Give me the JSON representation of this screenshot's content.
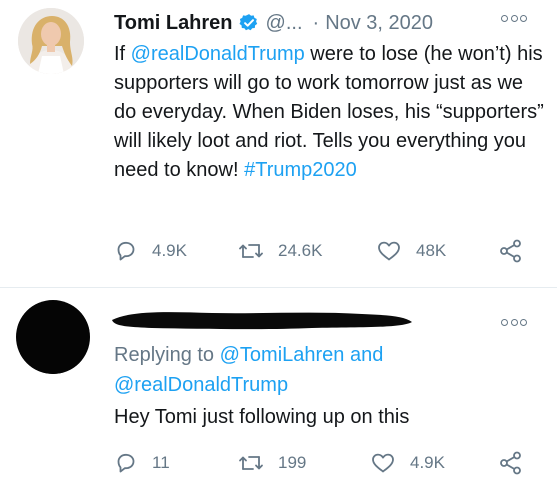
{
  "tweets": [
    {
      "author": {
        "name": "Tomi Lahren",
        "handle": "@...",
        "verified": true,
        "verified_color": "#1da1f2"
      },
      "separator": "·",
      "date": "Nov 3, 2020",
      "more_icon": "more-options-icon",
      "text_segments": [
        {
          "text": "If ",
          "link": false
        },
        {
          "text": "@realDonaldTrump",
          "link": true
        },
        {
          "text": " were to lose (he won’t) his supporters will go to work tomorrow just as we do everyday. When Biden loses, his “supporters” will likely loot and riot. Tells you everything you need to know! ",
          "link": false
        },
        {
          "text": "#Trump2020",
          "link": true
        }
      ],
      "stats": {
        "replies": "4.9K",
        "retweets": "24.6K",
        "likes": "48K"
      }
    },
    {
      "author": {
        "name_redacted": true,
        "avatar_redacted": true
      },
      "more_icon": "more-options-icon",
      "replying_to": {
        "prefix": "Replying to ",
        "user1": "@TomiLahren",
        "conjunction": " and",
        "user2": "@realDonaldTrump"
      },
      "text": "Hey Tomi just following up on this",
      "stats": {
        "replies": "11",
        "retweets": "199",
        "likes": "4.9K"
      }
    }
  ],
  "colors": {
    "link": "#1da1f2",
    "secondary_text": "#657786",
    "primary_text": "#14171a",
    "divider": "#e6ecf0"
  }
}
